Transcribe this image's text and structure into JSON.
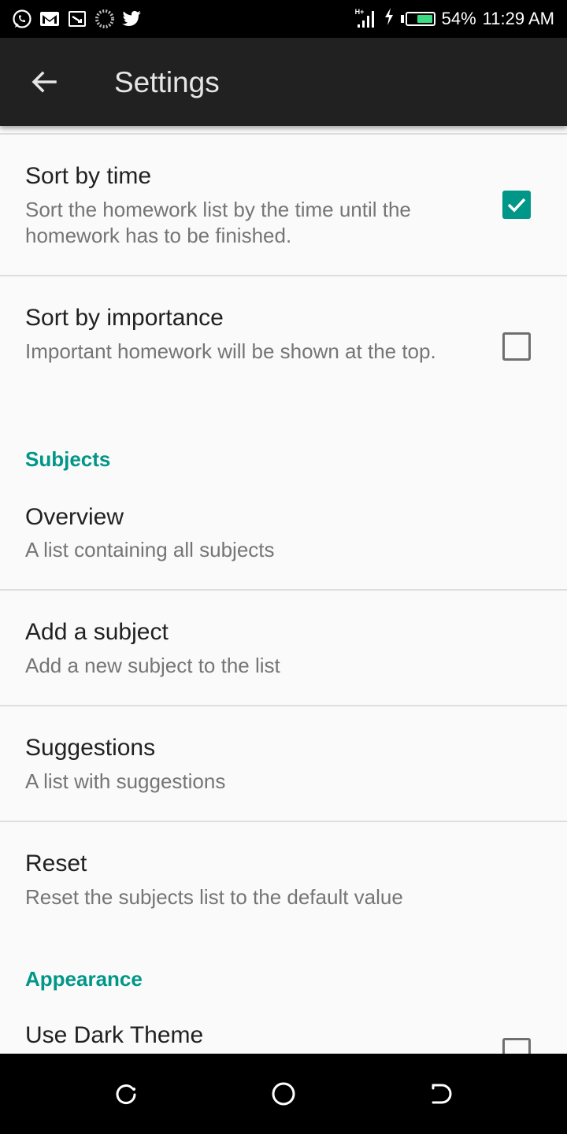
{
  "status_bar": {
    "icons": [
      "whatsapp-icon",
      "gmail-icon",
      "cast-icon",
      "loading-icon",
      "twitter-icon"
    ],
    "network_label": "H+",
    "battery_percent": 54,
    "battery_text": "54%",
    "time": "11:29 AM"
  },
  "toolbar": {
    "title": "Settings",
    "back_icon": "arrow-left-icon"
  },
  "colors": {
    "accent": "#009688",
    "toolbar_bg": "#212121",
    "background": "#fafafa"
  },
  "sections": {
    "sort": {
      "items": [
        {
          "title": "Sort by time",
          "summary": "Sort the homework list by the time until the homework has to be finished.",
          "checked": true
        },
        {
          "title": "Sort by importance",
          "summary": "Important homework will be shown at the top.",
          "checked": false
        }
      ]
    },
    "subjects": {
      "header": "Subjects",
      "items": [
        {
          "title": "Overview",
          "summary": "A list containing all subjects"
        },
        {
          "title": "Add a subject",
          "summary": "Add a new subject to the list"
        },
        {
          "title": "Suggestions",
          "summary": "A list with suggestions"
        },
        {
          "title": "Reset",
          "summary": "Reset the subjects list to the default value"
        }
      ]
    },
    "appearance": {
      "header": "Appearance",
      "items": [
        {
          "title": "Use Dark Theme",
          "checked": false
        }
      ]
    }
  },
  "nav_bar": {
    "buttons": [
      "recent-apps-icon",
      "home-icon",
      "back-icon"
    ]
  }
}
